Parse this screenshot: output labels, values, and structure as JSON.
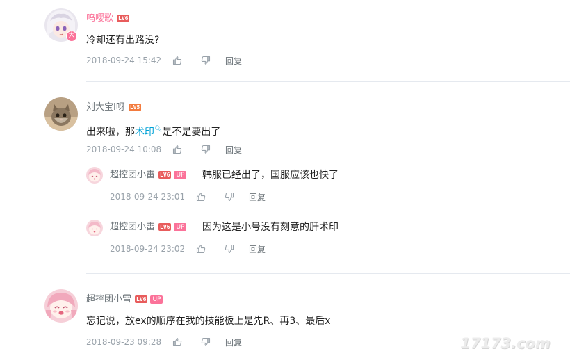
{
  "comments": [
    {
      "username": "呜嘤歌",
      "level": "LV6",
      "content": "冷却还有出路没?",
      "timestamp": "2018-09-24 15:42",
      "reply_label": "回复"
    },
    {
      "username": "刘大宝I呀",
      "level": "LV5",
      "content_pre": "出来啦，那",
      "content_link": "术印",
      "content_post": "是不是要出了",
      "timestamp": "2018-09-24 10:08",
      "reply_label": "回复",
      "replies": [
        {
          "username": "超控团小雷",
          "level": "LV6",
          "badge": "UP",
          "content": "韩服已经出了，国服应该也快了",
          "timestamp": "2018-09-24 23:01",
          "reply_label": "回复"
        },
        {
          "username": "超控团小雷",
          "level": "LV6",
          "badge": "UP",
          "content": "因为这是小号没有刻意的肝术印",
          "timestamp": "2018-09-24 23:02",
          "reply_label": "回复"
        }
      ]
    },
    {
      "username": "超控团小雷",
      "level": "LV6",
      "badge": "UP",
      "content": "忘记说，放ex的顺序在我的技能板上是先R、再3、最后x",
      "timestamp": "2018-09-23 09:28",
      "reply_label": "回复"
    }
  ],
  "watermark": "17173.com",
  "colors": {
    "username_pink": "#fb7299",
    "username_gray": "#6d757a",
    "link_blue": "#00a1d6",
    "meta_gray": "#99a2aa",
    "divider": "#e5e9ef"
  }
}
